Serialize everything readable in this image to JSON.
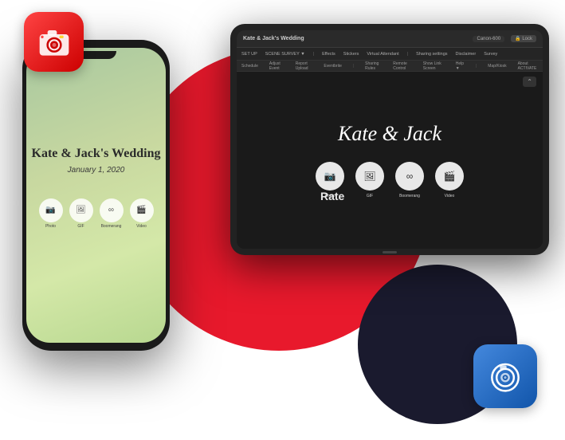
{
  "app": {
    "title": "Kate & Jack's Wedding",
    "date": "January 1, 2020"
  },
  "phone": {
    "title": "Kate & Jack's Wedding",
    "date": "January 1, 2020",
    "icons": [
      {
        "label": "Photo",
        "symbol": "📷"
      },
      {
        "label": "GIF",
        "symbol": "🖼"
      },
      {
        "label": "Boomerang",
        "symbol": "∞"
      },
      {
        "label": "Video",
        "symbol": "🎬"
      }
    ]
  },
  "tablet": {
    "menubar_title": "Kate & Jack's Wedding",
    "event_title": "Kate & Jack",
    "nav_items": [
      "SET UP",
      "SCENE SURVEY ▼",
      ""
    ],
    "nav_items2": [
      "Effects",
      "Stickers",
      "Virtual Attendant"
    ],
    "nav_items3": [
      "Sharing settings",
      "Disclaimer",
      "Survey"
    ],
    "nav_items4": [
      "Schedule",
      "Adjust Event",
      "Report Upload",
      "Eventbrite"
    ],
    "nav_items5": [
      "Sharing Rules",
      "Remote Control",
      "Show Link Screen",
      "Help ▼"
    ],
    "nav_items6": [
      "Map/Kiosk",
      "About ACTIVATE",
      ""
    ],
    "right_items": [
      "Canon-600",
      "Lock"
    ],
    "icons": [
      {
        "label": "Photo",
        "symbol": "📷"
      },
      {
        "label": "GIF",
        "symbol": "🖼"
      },
      {
        "label": "Boomerang",
        "symbol": "∞"
      },
      {
        "label": "Video",
        "symbol": "🎬"
      }
    ]
  },
  "app_icon_red": {
    "name": "Snappic iOS App",
    "color": "#cc0000"
  },
  "app_icon_blue": {
    "name": "Snappic iPad App",
    "color": "#1155aa"
  },
  "rate_label": "Rate"
}
